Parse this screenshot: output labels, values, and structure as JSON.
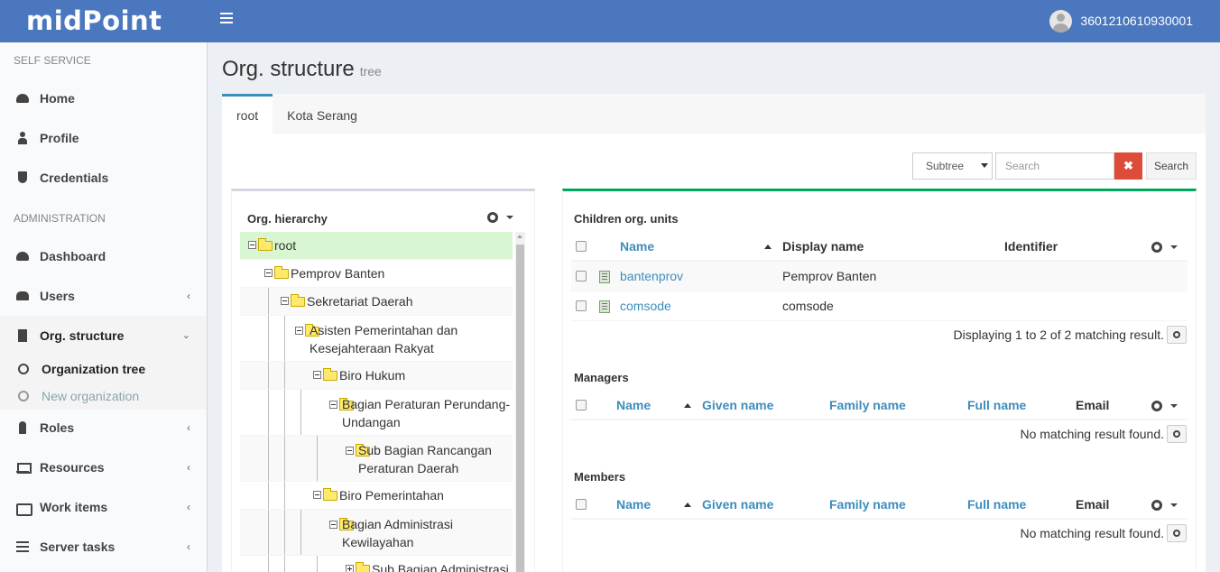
{
  "app": {
    "logo": "midPoint",
    "user": "3601210610930001"
  },
  "sidebar": {
    "self_service_header": "SELF SERVICE",
    "admin_header": "ADMINISTRATION",
    "items": [
      {
        "label": "Home",
        "icon": "dashboard-icon"
      },
      {
        "label": "Profile",
        "icon": "user-icon"
      },
      {
        "label": "Credentials",
        "icon": "shield-icon"
      },
      {
        "label": "Dashboard",
        "icon": "dashboard-icon"
      },
      {
        "label": "Users",
        "icon": "users-icon"
      },
      {
        "label": "Org. structure",
        "icon": "building-icon"
      },
      {
        "label": "Roles",
        "icon": "roles-icon"
      },
      {
        "label": "Resources",
        "icon": "laptop-icon"
      },
      {
        "label": "Work items",
        "icon": "inbox-icon"
      },
      {
        "label": "Server tasks",
        "icon": "tasks-icon"
      }
    ],
    "org_sub": [
      {
        "label": "Organization tree"
      },
      {
        "label": "New organization"
      }
    ]
  },
  "page": {
    "title": "Org. structure",
    "subtitle": "tree"
  },
  "tabs": [
    {
      "label": "root"
    },
    {
      "label": "Kota Serang"
    }
  ],
  "search": {
    "scope": "Subtree",
    "placeholder": "Search",
    "clear": "✖",
    "button": "Search"
  },
  "hierarchy": {
    "title": "Org. hierarchy",
    "nodes": [
      {
        "label": "root"
      },
      {
        "label": "Pemprov Banten"
      },
      {
        "label": "Sekretariat Daerah"
      },
      {
        "label": "Asisten Pemerintahan dan Kesejahteraan Rakyat"
      },
      {
        "label": "Biro Hukum"
      },
      {
        "label": "Bagian Peraturan Perundang-Undangan"
      },
      {
        "label": "Sub Bagian Rancangan Peraturan Daerah"
      },
      {
        "label": "Biro Pemerintahan"
      },
      {
        "label": "Bagian Administrasi Kewilayahan"
      },
      {
        "label": "Sub Bagian Administrasi"
      }
    ]
  },
  "children": {
    "title": "Children org. units",
    "columns": {
      "name": "Name",
      "display": "Display name",
      "identifier": "Identifier"
    },
    "rows": [
      {
        "name": "bantenprov",
        "display": "Pemprov Banten",
        "identifier": ""
      },
      {
        "name": "comsode",
        "display": "comsode",
        "identifier": ""
      }
    ],
    "footer": "Displaying 1 to 2 of 2 matching result."
  },
  "managers": {
    "title": "Managers",
    "columns": {
      "name": "Name",
      "given": "Given name",
      "family": "Family name",
      "full": "Full name",
      "email": "Email"
    },
    "footer": "No matching result found."
  },
  "members": {
    "title": "Members",
    "columns": {
      "name": "Name",
      "given": "Given name",
      "family": "Family name",
      "full": "Full name",
      "email": "Email"
    },
    "footer": "No matching result found."
  }
}
